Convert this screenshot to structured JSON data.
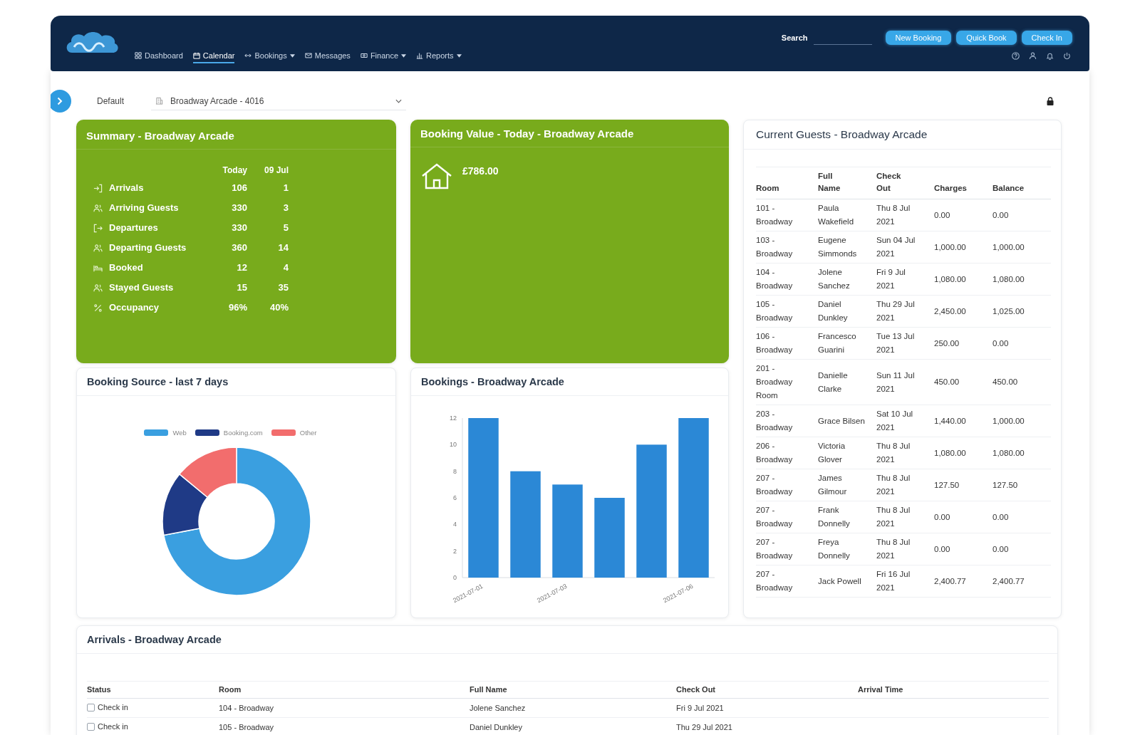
{
  "header": {
    "nav": [
      {
        "label": "Dashboard",
        "selected": false,
        "has_menu": false
      },
      {
        "label": "Calendar",
        "selected": true,
        "has_menu": false
      },
      {
        "label": "Bookings",
        "selected": false,
        "has_menu": true
      },
      {
        "label": "Messages",
        "selected": false,
        "has_menu": false
      },
      {
        "label": "Finance",
        "selected": false,
        "has_menu": true
      },
      {
        "label": "Reports",
        "selected": false,
        "has_menu": true
      }
    ],
    "search": {
      "label": "Search"
    },
    "buttons": [
      "New Booking",
      "Quick Book",
      "Check In"
    ]
  },
  "toolbar": {
    "view": "Default",
    "property": "Broadway Arcade - 4016"
  },
  "summary": {
    "title": "Summary - Broadway Arcade",
    "columns": [
      "Today",
      "09 Jul"
    ],
    "rows": [
      {
        "label": "Arrivals",
        "values": [
          "106",
          "1"
        ]
      },
      {
        "label": "Arriving Guests",
        "values": [
          "330",
          "3"
        ]
      },
      {
        "label": "Departures",
        "values": [
          "330",
          "5"
        ]
      },
      {
        "label": "Departing Guests",
        "values": [
          "360",
          "14"
        ]
      },
      {
        "label": "Booked",
        "values": [
          "12",
          "4"
        ]
      },
      {
        "label": "Stayed Guests",
        "values": [
          "15",
          "35"
        ]
      },
      {
        "label": "Occupancy",
        "values": [
          "96%",
          "40%"
        ]
      }
    ]
  },
  "booking_value": {
    "title": "Booking Value - Today - Broadway Arcade",
    "amount": "£786.00"
  },
  "current_guests": {
    "title": "Current Guests - Broadway Arcade",
    "columns": [
      "Room",
      "Full Name",
      "Check Out",
      "Charges",
      "Balance"
    ],
    "rows": [
      [
        "101 - Broadway",
        "Paula Wakefield",
        "Thu 8 Jul 2021",
        "0.00",
        "0.00"
      ],
      [
        "103 - Broadway",
        "Eugene Simmonds",
        "Sun 04 Jul 2021",
        "1,000.00",
        "1,000.00"
      ],
      [
        "104 - Broadway",
        "Jolene Sanchez",
        "Fri 9 Jul 2021",
        "1,080.00",
        "1,080.00"
      ],
      [
        "105 - Broadway",
        "Daniel Dunkley",
        "Thu 29 Jul 2021",
        "2,450.00",
        "1,025.00"
      ],
      [
        "106 - Broadway",
        "Francesco Guarini",
        "Tue 13 Jul 2021",
        "250.00",
        "0.00"
      ],
      [
        "201 - Broadway Room",
        "Danielle Clarke",
        "Sun 11 Jul 2021",
        "450.00",
        "450.00"
      ],
      [
        "203 - Broadway",
        "Grace Bilsen",
        "Sat 10 Jul 2021",
        "1,440.00",
        "1,000.00"
      ],
      [
        "206 - Broadway",
        "Victoria Glover",
        "Thu 8 Jul 2021",
        "1,080.00",
        "1,080.00"
      ],
      [
        "207 - Broadway",
        "James Gilmour",
        "Thu 8 Jul 2021",
        "127.50",
        "127.50"
      ],
      [
        "207 - Broadway",
        "Frank Donnelly",
        "Thu 8 Jul 2021",
        "0.00",
        "0.00"
      ],
      [
        "207 - Broadway",
        "Freya Donnelly",
        "Thu 8 Jul 2021",
        "0.00",
        "0.00"
      ],
      [
        "207 - Broadway",
        "Jack Powell",
        "Fri 16 Jul 2021",
        "2,400.77",
        "2,400.77"
      ]
    ]
  },
  "booking_source": {
    "title": "Booking Source - last 7 days",
    "chart_data": [
      {
        "type": "donut",
        "categories": [
          "Web",
          "Booking.com",
          "Other"
        ],
        "values": [
          72,
          14,
          14
        ],
        "colors": [
          "#3a9fe0",
          "#1f3a86",
          "#f26d6d"
        ],
        "legend": "top"
      }
    ]
  },
  "bookings": {
    "title": "Bookings - Broadway Arcade",
    "chart_data": [
      {
        "type": "bar",
        "categories": [
          "2021-07-01",
          null,
          "2021-07-03",
          null,
          null,
          "2021-07-06"
        ],
        "values": [
          12,
          8,
          7,
          6,
          10,
          12
        ],
        "color": "#2b88d6",
        "ylim": [
          0,
          12
        ],
        "yticks": [
          0,
          2,
          4,
          6,
          8,
          10,
          12
        ]
      }
    ]
  },
  "arrivals": {
    "title": "Arrivals - Broadway Arcade",
    "columns": [
      "Status",
      "Room",
      "Full Name",
      "Check Out",
      "Arrival Time"
    ],
    "rows": [
      {
        "checked": false,
        "cells": [
          "Check in",
          "104 - Broadway",
          "Jolene Sanchez",
          "Fri 9 Jul 2021"
        ]
      },
      {
        "checked": false,
        "cells": [
          "Check in",
          "105 - Broadway",
          "Daniel Dunkley",
          "Thu 29 Jul 2021"
        ]
      }
    ]
  }
}
